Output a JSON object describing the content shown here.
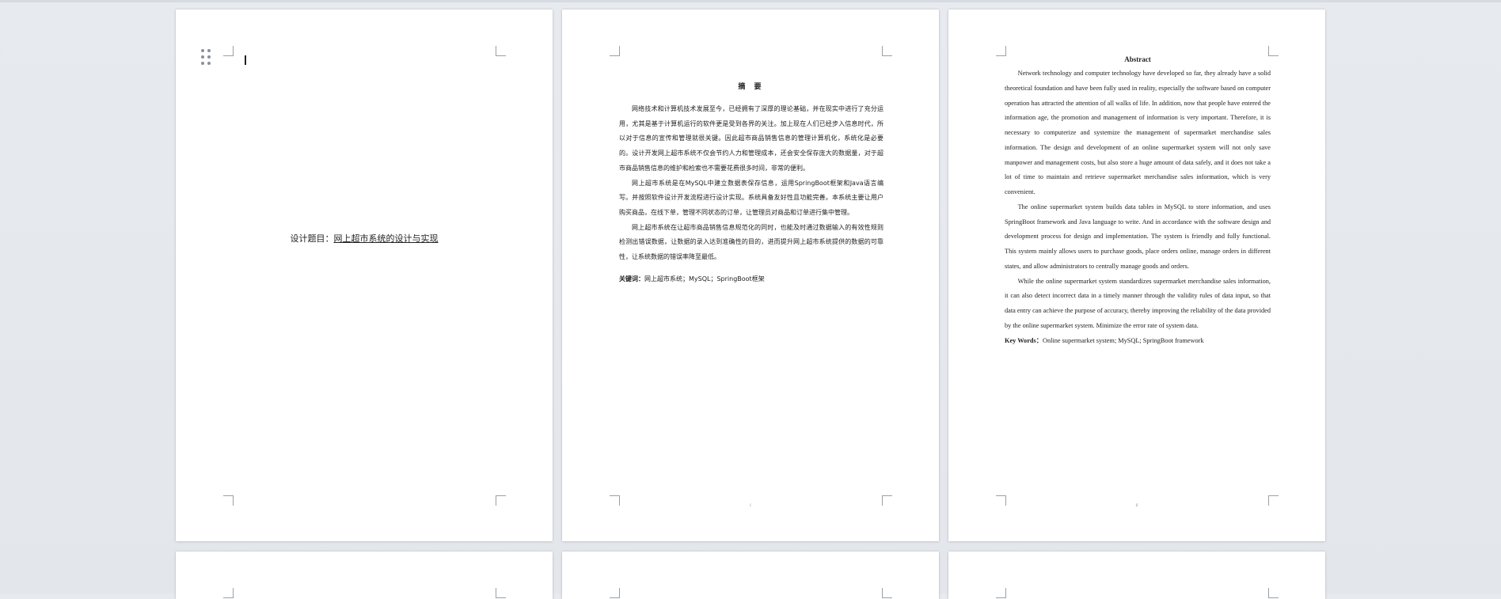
{
  "cover": {
    "title_label": "设计题目：",
    "title_value": "网上超市系统的设计与实现"
  },
  "abstract_cn": {
    "heading": "摘  要",
    "paragraphs": [
      "网络技术和计算机技术发展至今，已经拥有了深厚的理论基础，并在现实中进行了充分运用，尤其是基于计算机运行的软件更是受到各界的关注。加上现在人们已经步入信息时代，所以对于信息的宣传和管理就很关键。因此超市商品销售信息的管理计算机化，系统化是必要的。设计开发网上超市系统不仅会节约人力和管理成本，还会安全保存庞大的数据量，对于超市商品销售信息的维护和检索也不需要花费很多时间，非常的便利。",
      "网上超市系统是在MySQL中建立数据表保存信息，运用SpringBoot框架和Java语言编写。并按照软件设计开发流程进行设计实现。系统具备友好性且功能完善。本系统主要让用户购买商品，在线下单，管理不同状态的订单，让管理员对商品和订单进行集中管理。",
      "网上超市系统在让超市商品销售信息规范化的同时，也能及时通过数据输入的有效性规则检测出错误数据，让数据的录入达到准确性的目的，进而提升网上超市系统提供的数据的可靠性，让系统数据的错误率降至最低。"
    ],
    "keywords_label": "关键词：",
    "keywords": "网上超市系统；MySQL；SpringBoot框架",
    "page_number": "I"
  },
  "abstract_en": {
    "heading": "Abstract",
    "paragraphs": [
      "Network technology and computer technology have developed so far, they already have a solid theoretical foundation and have been fully used in reality, especially the software based on computer operation has attracted the attention of all walks of life. In addition, now that people have entered the information age, the promotion and management of information is very important. Therefore, it is necessary to computerize and systemize the management of supermarket merchandise sales information. The design and development of an online supermarket system will not only save manpower and management costs, but also store a huge amount of data safely, and it does not take a lot of time to maintain and retrieve supermarket merchandise sales information, which is very convenient.",
      "The online supermarket system builds data tables in MySQL to store information, and uses SpringBoot framework and Java language to write. And in accordance with the software design and development process for design and implementation. The system is friendly and fully functional. This system mainly allows users to purchase goods, place orders online, manage orders in different states, and allow administrators to centrally manage goods and orders.",
      "While the online supermarket system standardizes supermarket merchandise sales information, it can also detect incorrect data in a timely manner through the validity rules of data input, so that data entry can achieve the purpose of accuracy, thereby improving the reliability of the data provided by the online supermarket system. Minimize the error rate of system data."
    ],
    "keywords_label": "Key Words：",
    "keywords": "Online supermarket system; MySQL; SpringBoot framework",
    "page_number": "II"
  }
}
